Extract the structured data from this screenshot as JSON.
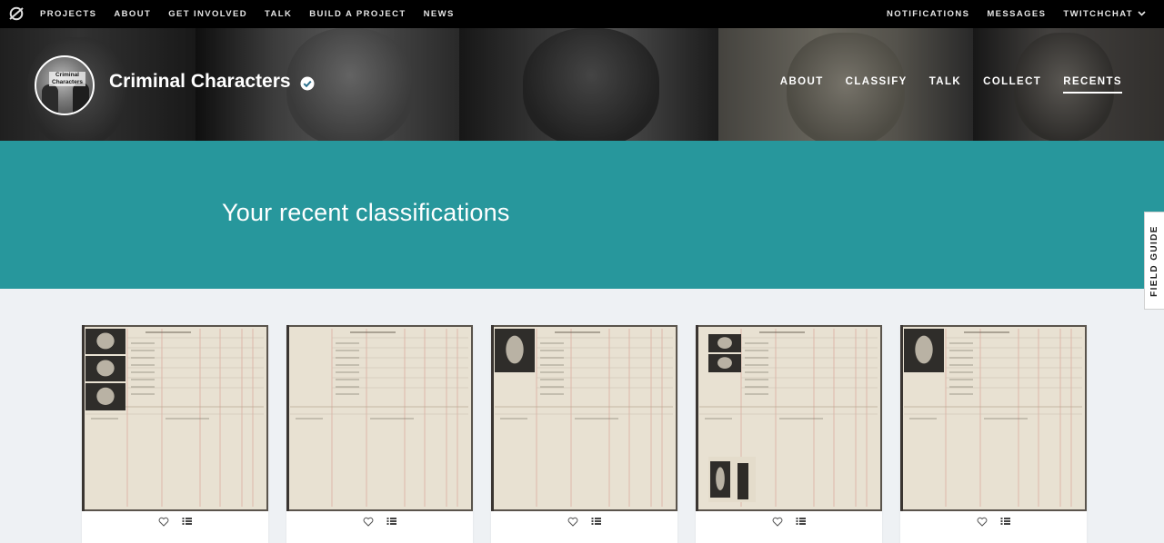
{
  "topnav": {
    "items": [
      "PROJECTS",
      "ABOUT",
      "GET INVOLVED",
      "TALK",
      "BUILD A PROJECT",
      "NEWS"
    ],
    "right": [
      "NOTIFICATIONS",
      "MESSAGES",
      "TWITCHCHAT"
    ]
  },
  "project": {
    "title": "Criminal Characters",
    "avatar_text": "Criminal Characters",
    "nav": [
      "ABOUT",
      "CLASSIFY",
      "TALK",
      "COLLECT",
      "RECENTS"
    ],
    "active_nav": "RECENTS"
  },
  "hero": {
    "heading": "Your recent classifications"
  },
  "field_guide": {
    "label": "FIELD GUIDE"
  },
  "recents": [
    {
      "photos": "three-stacked"
    },
    {
      "photos": "none"
    },
    {
      "photos": "one-top"
    },
    {
      "photos": "two-top-plus-full-body"
    },
    {
      "photos": "one-top"
    }
  ],
  "colors": {
    "hero": "#27979c",
    "topbar": "#000000",
    "accent": "#ffffff"
  },
  "icons": {
    "favorite": "heart-icon",
    "collect": "list-icon",
    "logo": "zooniverse-logo-icon",
    "verified": "check-badge-icon"
  }
}
